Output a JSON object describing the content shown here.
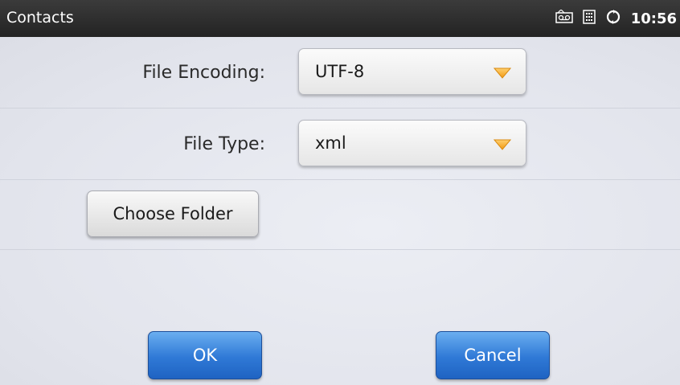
{
  "status_bar": {
    "title": "Contacts",
    "time": "10:56",
    "icons": [
      "voicemail-icon",
      "keypad-icon",
      "sync-icon"
    ]
  },
  "form": {
    "file_encoding_label": "File Encoding:",
    "file_encoding_value": "UTF-8",
    "file_type_label": "File Type:",
    "file_type_value": "xml",
    "choose_folder_label": "Choose Folder"
  },
  "actions": {
    "ok_label": "OK",
    "cancel_label": "Cancel"
  },
  "colors": {
    "primary_button": "#2f79d6",
    "dropdown_arrow": "#f5a623",
    "status_bar": "#2b2b2b"
  }
}
